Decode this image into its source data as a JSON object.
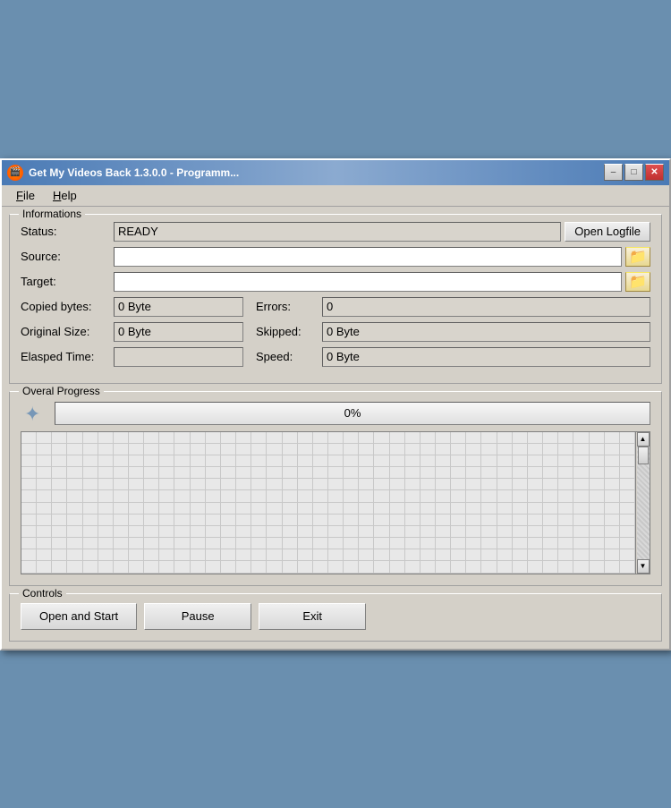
{
  "window": {
    "title": "Get My Videos Back 1.3.0.0 - Programm...",
    "icon": "🎬"
  },
  "titlebar": {
    "minimize_label": "–",
    "maximize_label": "□",
    "close_label": "✕"
  },
  "menubar": {
    "items": [
      {
        "id": "file",
        "label": "File",
        "underline_index": 0
      },
      {
        "id": "help",
        "label": "Help",
        "underline_index": 0
      }
    ]
  },
  "informations": {
    "group_label": "Informations",
    "status_label": "Status:",
    "status_value": "READY",
    "open_logfile_label": "Open Logfile",
    "source_label": "Source:",
    "source_value": "",
    "source_placeholder": "",
    "target_label": "Target:",
    "target_value": "",
    "copied_bytes_label": "Copied bytes:",
    "copied_bytes_value": "0 Byte",
    "errors_label": "Errors:",
    "errors_value": "0",
    "original_size_label": "Original Size:",
    "original_size_value": "0 Byte",
    "skipped_label": "Skipped:",
    "skipped_value": "0 Byte",
    "elapsed_time_label": "Elasped Time:",
    "elapsed_time_value": "",
    "speed_label": "Speed:",
    "speed_value": "0 Byte"
  },
  "progress": {
    "group_label": "Overal Progress",
    "percent": "0%",
    "fill_width": 0
  },
  "controls": {
    "group_label": "Controls",
    "open_start_label": "Open and Start",
    "pause_label": "Pause",
    "exit_label": "Exit"
  }
}
